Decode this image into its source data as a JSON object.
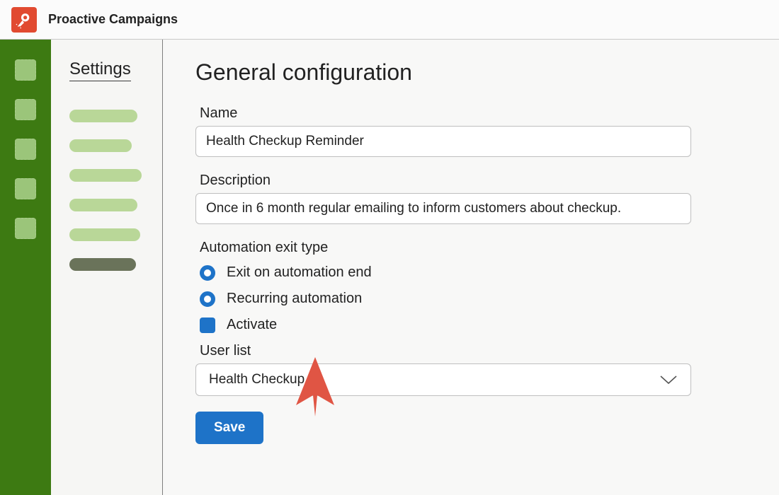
{
  "header": {
    "appTitle": "Proactive Campaigns"
  },
  "sidebar": {
    "title": "Settings"
  },
  "page": {
    "title": "General configuration",
    "nameLabel": "Name",
    "nameValue": "Health Checkup Reminder",
    "descriptionLabel": "Description",
    "descriptionValue": "Once in 6 month regular emailing to inform customers about checkup.",
    "exitTypeHeading": "Automation exit type",
    "options": {
      "exitOnEnd": "Exit on automation end",
      "recurring": "Recurring automation",
      "activate": "Activate"
    },
    "userListLabel": "User list",
    "userListValue": "Health Checkup",
    "saveLabel": "Save"
  }
}
